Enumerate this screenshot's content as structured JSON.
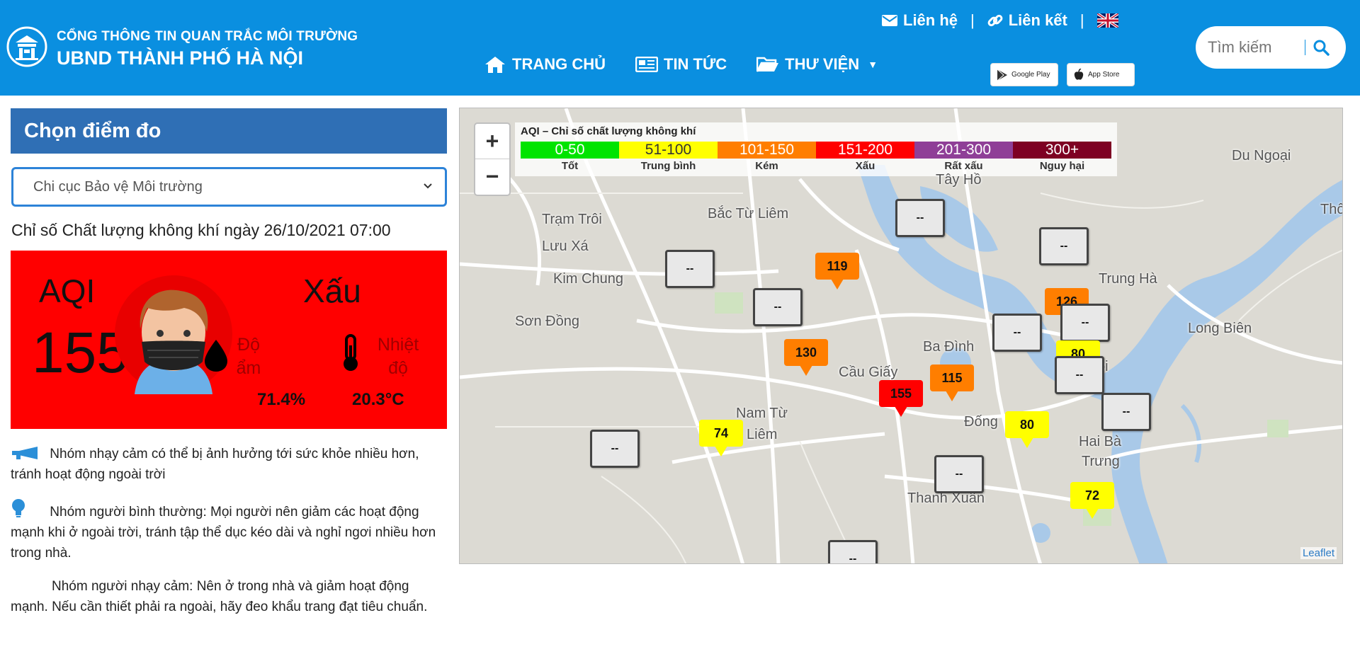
{
  "header": {
    "brand_line1": "CỔNG THÔNG TIN QUAN TRẮC MÔI TRƯỜNG",
    "brand_line2": "UBND THÀNH PHỐ HÀ NỘI",
    "top_links": {
      "contact": "Liên hệ",
      "links": "Liên kết",
      "separator": "|"
    },
    "nav": {
      "home": "TRANG CHỦ",
      "news": "TIN TỨC",
      "library": "THƯ VIỆN"
    },
    "badges": {
      "google_play": "Google Play",
      "app_store": "App Store"
    },
    "search_placeholder": "Tìm kiếm",
    "colors": {
      "header_bg": "#0a8fe0"
    }
  },
  "panel": {
    "title": "Chọn điểm đo",
    "selected_station": "Chi cục Bảo vệ Môi trường",
    "heading": "Chỉ số Chất lượng không khí ngày 26/10/2021 07:00",
    "aqi_label": "AQI",
    "aqi_value": "155",
    "status": "Xấu",
    "status_color": "#ff0000",
    "humidity_label_1": "Độ",
    "humidity_label_2": "ẩm",
    "humidity_value": "71.4%",
    "temperature_label_1": "Nhiệt",
    "temperature_label_2": "độ",
    "temperature_value": "20.3°C"
  },
  "advice": [
    {
      "icon": "megaphone-icon",
      "text": "Nhóm nhạy cảm có thể bị ảnh hưởng tới sức khỏe nhiều hơn, tránh hoạt động ngoài trời"
    },
    {
      "icon": "lightbulb-icon",
      "text": "Nhóm người bình thường: Mọi người nên giảm các hoạt động mạnh khi ở ngoài trời, tránh tập thể dục kéo dài và nghỉ ngơi nhiều hơn trong nhà."
    },
    {
      "icon": "none",
      "text": "Nhóm người nhạy cảm: Nên ở trong nhà và giảm hoạt động mạnh. Nếu cần thiết phải ra ngoài, hãy đeo khẩu trang đạt tiêu chuẩn."
    }
  ],
  "map": {
    "zoom_in": "+",
    "zoom_out": "−",
    "legend_title": "AQI – Chỉ số chất lượng không khí",
    "legend": [
      {
        "range": "0-50",
        "label": "Tốt",
        "color": "#00e400"
      },
      {
        "range": "51-100",
        "label": "Trung bình",
        "color": "#ffff00"
      },
      {
        "range": "101-150",
        "label": "Kém",
        "color": "#ff7e00"
      },
      {
        "range": "151-200",
        "label": "Xấu",
        "color": "#ff0000"
      },
      {
        "range": "201-300",
        "label": "Rất xấu",
        "color": "#8f3f97"
      },
      {
        "range": "300+",
        "label": "Nguy hại",
        "color": "#7e0023"
      }
    ],
    "places": [
      "Du Ngoại",
      "Thô",
      "Bắc Từ Liêm",
      "Trạm Trôi",
      "Lưu Xá",
      "Kim Chung",
      "Trung Hà",
      "Sơn Đồng",
      "Long Biên",
      "Ba Đình",
      "Cầu Giấy",
      "Nam Từ",
      "Liêm",
      "Đống",
      "Hai Bà",
      "Trưng",
      "Thanh Xuân",
      "Tây Hồ",
      "ội"
    ],
    "markers": [
      "--",
      "--",
      "119",
      "--",
      "--",
      "126",
      "--",
      "130",
      "--",
      "80",
      "--",
      "115",
      "155",
      "--",
      "80",
      "74",
      "--",
      "--",
      "72",
      "--"
    ],
    "attribution": "Leaflet"
  }
}
